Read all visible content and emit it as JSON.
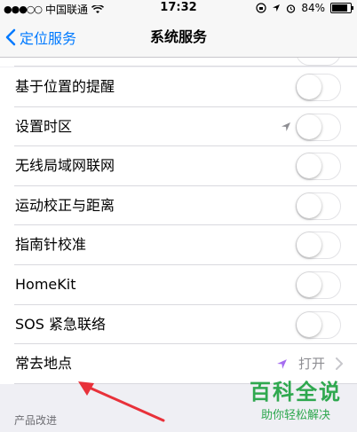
{
  "status_bar": {
    "carrier": "中国联通",
    "time": "17:32",
    "battery": "84%",
    "battery_level": 0.84
  },
  "nav": {
    "back_label": "定位服务",
    "title": "系统服务"
  },
  "rows": [
    {
      "label": "基于位置的提醒",
      "toggle_on": false
    },
    {
      "label": "设置时区",
      "toggle_on": false,
      "location_icon": "gray-location-arrow-icon"
    },
    {
      "label": "无线局域网联网",
      "toggle_on": false
    },
    {
      "label": "运动校正与距离",
      "toggle_on": false
    },
    {
      "label": "指南针校准",
      "toggle_on": false
    },
    {
      "label": "HomeKit",
      "toggle_on": false
    },
    {
      "label": "SOS 紧急联络",
      "toggle_on": false
    },
    {
      "label": "常去地点",
      "value": "打开",
      "location_icon": "purple-location-arrow-icon"
    }
  ],
  "section_header": "产品改进",
  "watermark": {
    "main": "百科全说",
    "sub": "助你轻松解决"
  },
  "colors": {
    "accent": "#007aff",
    "annotation": "#e8313a",
    "watermark": "#2fa84f",
    "location_purple": "#a56cf0"
  }
}
